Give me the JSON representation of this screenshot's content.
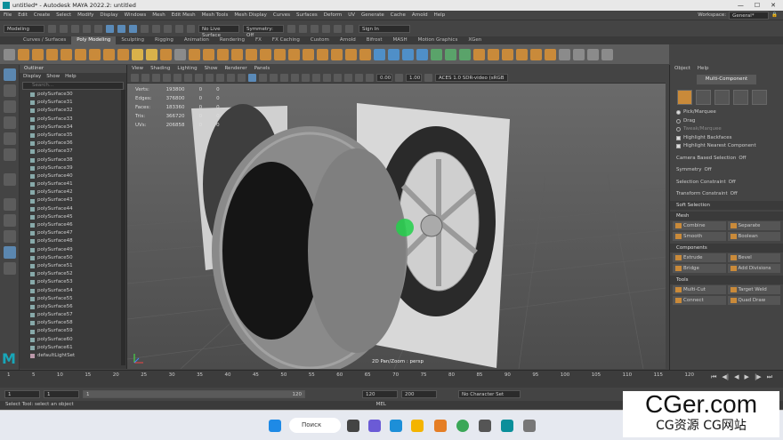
{
  "window": {
    "title": "untitled* - Autodesk MAYA 2022.2: untitled"
  },
  "menubar": {
    "items": [
      "File",
      "Edit",
      "Create",
      "Select",
      "Modify",
      "Display",
      "Windows",
      "Mesh",
      "Edit Mesh",
      "Mesh Tools",
      "Mesh Display",
      "Curves",
      "Surfaces",
      "Deform",
      "UV",
      "Generate",
      "Cache",
      "Arnold",
      "Help"
    ],
    "workspace_label": "Workspace:",
    "workspace_value": "General*"
  },
  "statusline": {
    "mode": "Modeling",
    "live_surface": "No Live Surface",
    "symmetry": "Symmetry: Off",
    "sign_in": "Sign In"
  },
  "shelf_tabs": [
    "Curves / Surfaces",
    "Poly Modeling",
    "Sculpting",
    "Rigging",
    "Animation",
    "Rendering",
    "FX",
    "FX Caching",
    "Custom",
    "Arnold",
    "Bifrost",
    "MASH",
    "Motion Graphics",
    "XGen"
  ],
  "shelf_active": "Poly Modeling",
  "outliner": {
    "title": "Outliner",
    "menu": [
      "Display",
      "Show",
      "Help"
    ],
    "search_placeholder": "Search...",
    "items": [
      "polySurface30",
      "polySurface31",
      "polySurface32",
      "polySurface33",
      "polySurface34",
      "polySurface35",
      "polySurface36",
      "polySurface37",
      "polySurface38",
      "polySurface39",
      "polySurface40",
      "polySurface41",
      "polySurface42",
      "polySurface43",
      "polySurface44",
      "polySurface45",
      "polySurface46",
      "polySurface47",
      "polySurface48",
      "polySurface49",
      "polySurface50",
      "polySurface51",
      "polySurface52",
      "polySurface53",
      "polySurface54",
      "polySurface55",
      "polySurface56",
      "polySurface57",
      "polySurface58",
      "polySurface59",
      "polySurface60",
      "polySurface61",
      "defaultLightSet"
    ]
  },
  "viewport": {
    "menu": [
      "View",
      "Shading",
      "Lighting",
      "Show",
      "Renderer",
      "Panels"
    ],
    "toolbar": {
      "exposure": "0.00",
      "gamma": "1.00",
      "colorspace": "ACES 1.0 SDR-video (sRGB"
    },
    "hud": [
      {
        "label": "Verts:",
        "v1": "193800",
        "v2": "0",
        "v3": "0"
      },
      {
        "label": "Edges:",
        "v1": "376800",
        "v2": "0",
        "v3": "0"
      },
      {
        "label": "Faces:",
        "v1": "183360",
        "v2": "0",
        "v3": "0"
      },
      {
        "label": "Tris:",
        "v1": "366720",
        "v2": "0",
        "v3": "0"
      },
      {
        "label": "UVs:",
        "v1": "206858",
        "v2": "0",
        "v3": "0"
      }
    ],
    "camera_label": "2D Pan/Zoom : persp"
  },
  "attr_panel": {
    "menu": [
      "Object",
      "Help"
    ],
    "title": "Multi-Component",
    "options": [
      {
        "label": "Pick/Marquee",
        "type": "radio",
        "on": true
      },
      {
        "label": "Drag",
        "type": "radio",
        "on": false
      },
      {
        "label": "Tweak/Marquee",
        "type": "radio",
        "on": false
      },
      {
        "label": "Highlight Backfaces",
        "type": "check",
        "on": true
      },
      {
        "label": "Highlight Nearest Component",
        "type": "check",
        "on": true
      }
    ],
    "camera_based": "Camera Based Selection",
    "camera_based_value": "Off",
    "symmetry": "Symmetry",
    "symmetry_value": "Off",
    "selection_constraint": "Selection Constraint",
    "selection_constraint_value": "Off",
    "transform_constraint": "Transform Constraint",
    "transform_constraint_value": "Off",
    "soft_selection": "Soft Selection",
    "sections": [
      {
        "name": "Mesh",
        "buttons": [
          "Combine",
          "Separate",
          "Smooth",
          "Boolean"
        ]
      },
      {
        "name": "Components",
        "buttons": [
          "Extrude",
          "Bevel",
          "Bridge",
          "Add Divisions"
        ]
      },
      {
        "name": "Tools",
        "buttons": [
          "Multi-Cut",
          "Target Weld",
          "Connect",
          "Quad Draw"
        ]
      }
    ]
  },
  "timeline": {
    "start": "1",
    "current": "1",
    "slider_start": "1",
    "slider_end": "120",
    "end": "120",
    "max_end": "200",
    "character_set": "No Character Set",
    "ticks": [
      "1",
      "5",
      "10",
      "15",
      "20",
      "25",
      "30",
      "35",
      "40",
      "45",
      "50",
      "55",
      "60",
      "65",
      "70",
      "75",
      "80",
      "85",
      "90",
      "95",
      "100",
      "105",
      "110",
      "115",
      "120"
    ]
  },
  "helpline": {
    "text": "Select Tool: select an object",
    "mel": "MEL"
  },
  "taskbar": {
    "search": "Поиск"
  },
  "watermark": {
    "main": "CGer.com",
    "sub": "CG资源 CG网站"
  }
}
